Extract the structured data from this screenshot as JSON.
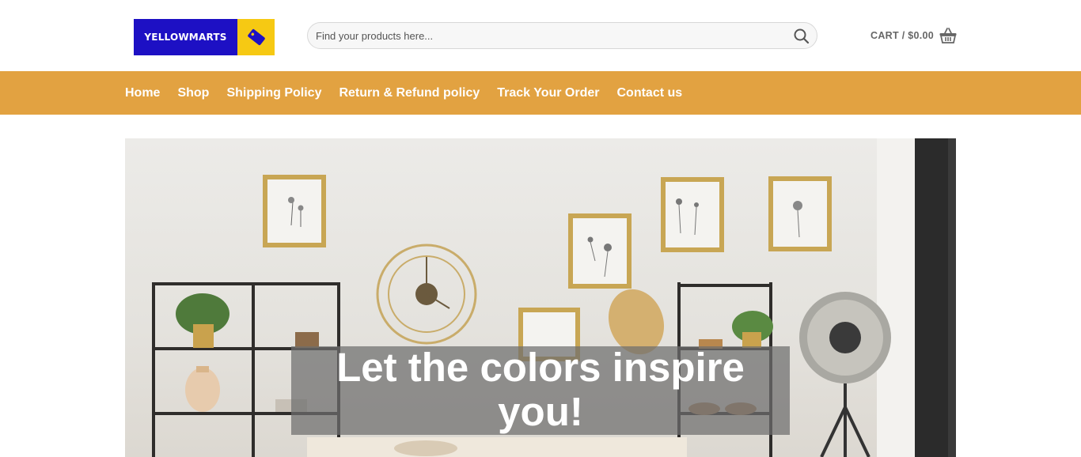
{
  "header": {
    "logo_text": "YELLOWMARTS",
    "search": {
      "placeholder": "Find your products here...",
      "value": ""
    },
    "cart_label": "CART / $0.00",
    "icons": {
      "search": "search-icon",
      "cart": "basket-icon",
      "logo": "tag-icon"
    }
  },
  "nav": {
    "items": [
      {
        "label": "Home"
      },
      {
        "label": "Shop"
      },
      {
        "label": "Shipping Policy"
      },
      {
        "label": "Return & Refund policy"
      },
      {
        "label": "Track Your Order"
      },
      {
        "label": "Contact us"
      }
    ]
  },
  "hero": {
    "title": "Let the colors inspire you!"
  },
  "colors": {
    "nav_bg": "#e2a241",
    "logo_blue": "#1d10c4",
    "logo_yellow": "#f6c913"
  }
}
